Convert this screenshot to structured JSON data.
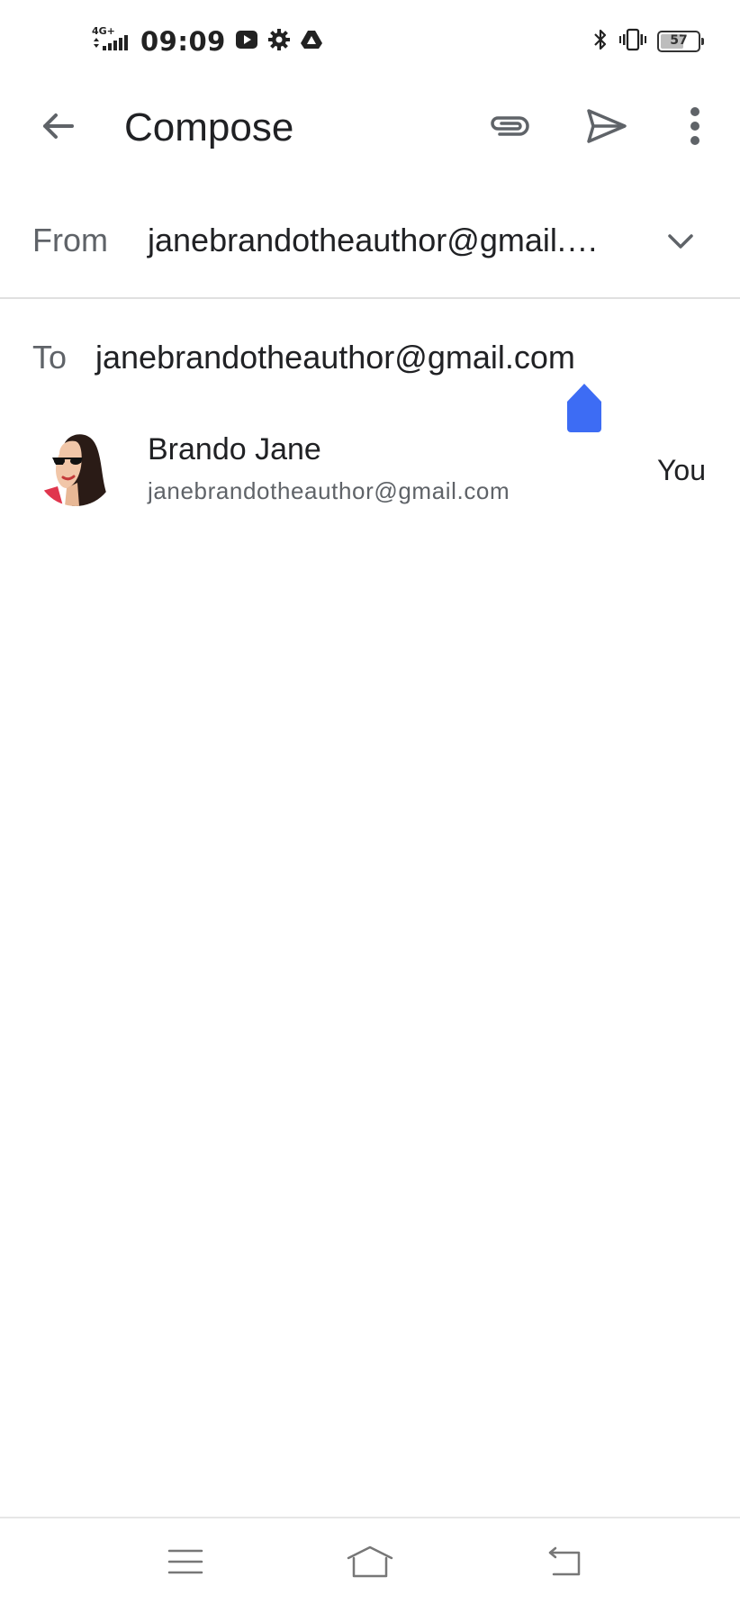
{
  "status_bar": {
    "network": "4G+",
    "time": "09:09",
    "battery_level": "57",
    "icons": [
      "signal-icon",
      "youtube-icon",
      "settings-gear-icon",
      "drive-icon",
      "bluetooth-icon",
      "vibrate-icon",
      "battery-icon"
    ]
  },
  "app_bar": {
    "title": "Compose",
    "icons": [
      "back-arrow-icon",
      "paperclip-icon",
      "send-icon",
      "more-vert-icon"
    ]
  },
  "from": {
    "label": "From",
    "value": "janebrandotheauthor@gmail.…"
  },
  "to": {
    "label": "To",
    "value": "janebrandotheauthor@gmail.com"
  },
  "suggestion": {
    "name": "Brando Jane",
    "email": "janebrandotheauthor@gmail.com",
    "tag": "You"
  },
  "nav_bar": {
    "icons": [
      "menu-icon",
      "home-icon",
      "back-icon"
    ]
  },
  "colors": {
    "accent": "#3d6cf4",
    "text_primary": "#202124",
    "text_secondary": "#5f6368",
    "divider": "#e0e0e0"
  }
}
